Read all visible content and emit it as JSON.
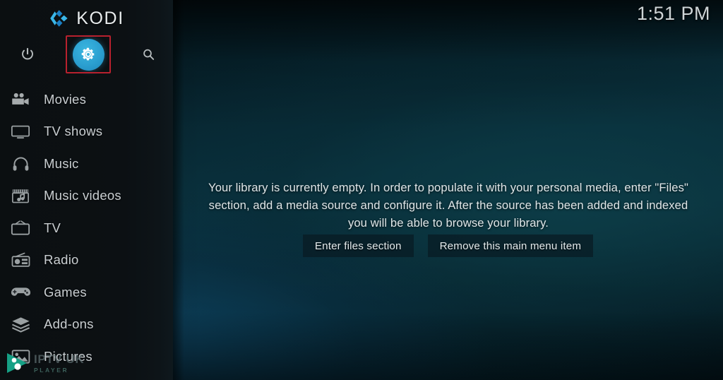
{
  "app": {
    "name": "KODI",
    "logo_icon": "kodi-logo-icon"
  },
  "clock": {
    "time": "1:51 PM"
  },
  "sidebar": {
    "top_actions": [
      {
        "name": "power",
        "icon": "power-icon",
        "label": "Power"
      },
      {
        "name": "settings",
        "icon": "gear-icon",
        "label": "Settings",
        "highlighted": true
      },
      {
        "name": "search",
        "icon": "search-icon",
        "label": "Search"
      }
    ],
    "items": [
      {
        "label": "Movies",
        "icon": "movie-camera-icon"
      },
      {
        "label": "TV shows",
        "icon": "television-icon"
      },
      {
        "label": "Music",
        "icon": "headphones-icon"
      },
      {
        "label": "Music videos",
        "icon": "music-video-icon"
      },
      {
        "label": "TV",
        "icon": "tv-box-icon"
      },
      {
        "label": "Radio",
        "icon": "radio-icon"
      },
      {
        "label": "Games",
        "icon": "gamepad-icon"
      },
      {
        "label": "Add-ons",
        "icon": "addons-box-icon"
      },
      {
        "label": "Pictures",
        "icon": "pictures-icon"
      }
    ]
  },
  "main": {
    "empty_message": "Your library is currently empty. In order to populate it with your personal media, enter \"Files\" section, add a media source and configure it. After the source has been added and indexed you will be able to browse your library.",
    "buttons": [
      {
        "label": "Enter files section"
      },
      {
        "label": "Remove this main menu item"
      }
    ]
  },
  "watermark": {
    "main": "IPTV UK",
    "sub": "PLAYER",
    "icon": "play-button-icon"
  },
  "colors": {
    "accent_blue": "#2ba5d8",
    "highlight_red": "#b8212e",
    "sidebar_bg": "#0c1013",
    "background_teal": "#0a3442",
    "text_primary": "#dfe6e8",
    "text_menu": "#c9ced1",
    "watermark_teal": "#16a085"
  }
}
